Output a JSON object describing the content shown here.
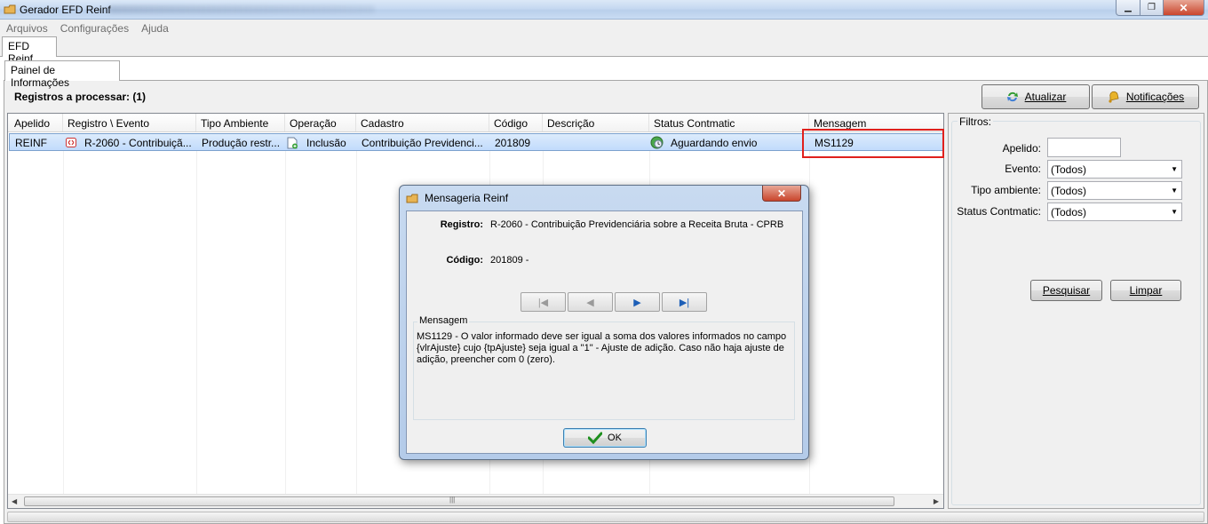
{
  "window": {
    "title": "Gerador EFD Reinf"
  },
  "menu": {
    "items": [
      "Arquivos",
      "Configurações",
      "Ajuda"
    ]
  },
  "tabs": {
    "outer": "EFD Reinf",
    "inner": "Painel de Informações"
  },
  "panel": {
    "registros_label": "Registros a processar: (1)"
  },
  "toolbar": {
    "atualizar_label": "Atualizar",
    "notificacoes_label": "Notificações"
  },
  "grid": {
    "columns": [
      "Apelido",
      "Registro \\ Evento",
      "Tipo Ambiente",
      "Operação",
      "Cadastro",
      "Código",
      "Descrição",
      "Status Contmatic",
      "Mensagem"
    ],
    "rows": [
      {
        "apelido": "REINF",
        "registro": "R-2060 - Contribuiçã...",
        "tipo_ambiente": "Produção restr...",
        "operacao": "Inclusão",
        "cadastro": "Contribuição Previdenci...",
        "codigo": "201809",
        "descricao": "",
        "status": "Aguardando envio",
        "mensagem": "MS1129"
      }
    ]
  },
  "filters": {
    "title": "Filtros:",
    "apelido_label": "Apelido:",
    "apelido_value": "",
    "evento_label": "Evento:",
    "evento_value": "(Todos)",
    "tipo_label": "Tipo ambiente:",
    "tipo_value": "(Todos)",
    "status_label": "Status Contmatic:",
    "status_value": "(Todos)",
    "pesquisar_label": "Pesquisar",
    "limpar_label": "Limpar"
  },
  "dialog": {
    "title": "Mensageria Reinf",
    "close_glyph": "✕",
    "registro_label": "Registro:",
    "registro_value": "R-2060 - Contribuição Previdenciária sobre a Receita Bruta - CPRB",
    "codigo_label": "Código:",
    "codigo_value": "201809 -",
    "mensagem_title": "Mensagem",
    "mensagem_text": "MS1129 - O valor informado deve ser igual a soma dos valores informados no campo {vlrAjuste} cujo {tpAjuste} seja igual a \"1\" - Ajuste de adição. Caso não haja ajuste de adição, preencher com 0 (zero).",
    "ok_label": "OK"
  },
  "colors": {
    "highlight": "#e0201c",
    "selection": "#c1dbfc",
    "ok_check": "#1e8f1e"
  }
}
